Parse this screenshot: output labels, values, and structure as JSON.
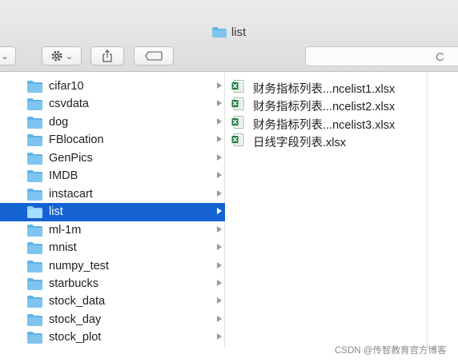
{
  "window": {
    "title": "list"
  },
  "toolbar": {
    "share_icon": "share-icon",
    "tag_icon": "tag-icon",
    "gear_icon": "gear-icon"
  },
  "search": {
    "partial_text": "C"
  },
  "folders": [
    {
      "label": "cifar10",
      "selected": false
    },
    {
      "label": "csvdata",
      "selected": false
    },
    {
      "label": "dog",
      "selected": false
    },
    {
      "label": "FBlocation",
      "selected": false
    },
    {
      "label": "GenPics",
      "selected": false
    },
    {
      "label": "IMDB",
      "selected": false
    },
    {
      "label": "instacart",
      "selected": false
    },
    {
      "label": "list",
      "selected": true
    },
    {
      "label": "ml-1m",
      "selected": false
    },
    {
      "label": "mnist",
      "selected": false
    },
    {
      "label": "numpy_test",
      "selected": false
    },
    {
      "label": "starbucks",
      "selected": false
    },
    {
      "label": "stock_data",
      "selected": false
    },
    {
      "label": "stock_day",
      "selected": false
    },
    {
      "label": "stock_plot",
      "selected": false
    }
  ],
  "files": [
    {
      "label": "财务指标列表...ncelist1.xlsx"
    },
    {
      "label": "财务指标列表...ncelist2.xlsx"
    },
    {
      "label": "财务指标列表...ncelist3.xlsx"
    },
    {
      "label": "日线字段列表.xlsx"
    }
  ],
  "watermark": "CSDN @传智教育官方博客",
  "colors": {
    "selection": "#1462d1",
    "folder": "#5fb3e8",
    "excel": "#1e7a3c"
  }
}
